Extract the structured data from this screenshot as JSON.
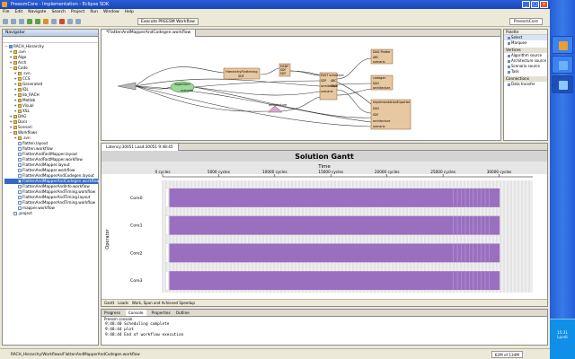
{
  "window": {
    "title": "PreesmCore - Implementation - Eclipse SDK",
    "controls": [
      "_",
      "□",
      "×"
    ]
  },
  "menubar": [
    "File",
    "Edit",
    "Navigate",
    "Search",
    "Project",
    "Run",
    "Window",
    "Help"
  ],
  "toolbar": {
    "execute_label": "Execute PREESM Workflow",
    "perspective": "PreesmCore"
  },
  "navigator": {
    "title": "Navigator",
    "rows": [
      {
        "label": "RACH_Hierarchy",
        "indent": 0,
        "kind": "proj",
        "twist": "−"
      },
      {
        "label": ".svn",
        "indent": 1,
        "kind": "folder",
        "twist": "+"
      },
      {
        "label": "Algo",
        "indent": 1,
        "kind": "folder",
        "twist": "+"
      },
      {
        "label": "Arch",
        "indent": 1,
        "kind": "folder",
        "twist": "+"
      },
      {
        "label": "Code",
        "indent": 1,
        "kind": "folder",
        "twist": "−"
      },
      {
        "label": ".svn",
        "indent": 2,
        "kind": "folder",
        "twist": "+"
      },
      {
        "label": "CCS",
        "indent": 2,
        "kind": "folder",
        "twist": "+"
      },
      {
        "label": "Generated",
        "indent": 2,
        "kind": "folder",
        "twist": "+"
      },
      {
        "label": "IDL",
        "indent": 2,
        "kind": "folder",
        "twist": "+"
      },
      {
        "label": "lib_RACH",
        "indent": 2,
        "kind": "folder",
        "twist": "+"
      },
      {
        "label": "Matlab",
        "indent": 2,
        "kind": "folder",
        "twist": "+"
      },
      {
        "label": "Visual",
        "indent": 2,
        "kind": "folder",
        "twist": "+"
      },
      {
        "label": "XSL",
        "indent": 2,
        "kind": "folder",
        "twist": "+"
      },
      {
        "label": "DAG",
        "indent": 1,
        "kind": "folder",
        "twist": "+"
      },
      {
        "label": "Docs",
        "indent": 1,
        "kind": "folder",
        "twist": "+"
      },
      {
        "label": "Scenari",
        "indent": 1,
        "kind": "folder",
        "twist": "+"
      },
      {
        "label": "Workflows",
        "indent": 1,
        "kind": "folder",
        "twist": "−"
      },
      {
        "label": ".svn",
        "indent": 2,
        "kind": "folder",
        "twist": "+"
      },
      {
        "label": "flatten.layout",
        "indent": 2,
        "kind": "file",
        "twist": ""
      },
      {
        "label": "flatten.workflow",
        "indent": 2,
        "kind": "file",
        "twist": ""
      },
      {
        "label": "FlattenAndFastMapper.layout",
        "indent": 2,
        "kind": "file",
        "twist": ""
      },
      {
        "label": "FlattenAndFastMapper.workflow",
        "indent": 2,
        "kind": "file",
        "twist": ""
      },
      {
        "label": "FlattenAndMapper.layout",
        "indent": 2,
        "kind": "file",
        "twist": ""
      },
      {
        "label": "FlattenAndMapper.workflow",
        "indent": 2,
        "kind": "file",
        "twist": ""
      },
      {
        "label": "FlattenAndMapperAndCodegen.layout",
        "indent": 2,
        "kind": "file",
        "twist": ""
      },
      {
        "label": "FlattenAndMapperAndCodegen.workflow",
        "indent": 2,
        "kind": "file",
        "twist": "",
        "selected": true
      },
      {
        "label": "FlattenAndMapperAndInfo.workflow",
        "indent": 2,
        "kind": "file",
        "twist": ""
      },
      {
        "label": "FlattenAndMapperAndTiming.workflow",
        "indent": 2,
        "kind": "file",
        "twist": ""
      },
      {
        "label": "FlattenAndMapperAndTiming.layout",
        "indent": 2,
        "kind": "file",
        "twist": ""
      },
      {
        "label": "FlattenAndMapperAndTiming.workflow",
        "indent": 2,
        "kind": "file",
        "twist": ""
      },
      {
        "label": "mapper.workflow",
        "indent": 2,
        "kind": "file",
        "twist": ""
      },
      {
        "label": ".project",
        "indent": 1,
        "kind": "file",
        "twist": ""
      }
    ]
  },
  "editor": {
    "tab": "*FlattenAndMapperAndCodegen.workflow",
    "nodes": {
      "hier": {
        "title": "HierarchyFlattening",
        "port": "SDF"
      },
      "algo": "algorithm",
      "scen": "scenario",
      "arch": "architecture",
      "hsdf": {
        "title": "HSDF",
        "ports": [
          "SDF",
          "SDF"
        ]
      },
      "fast": {
        "title": "FAST scheduler",
        "ports": [
          "SDF",
          "architecture",
          "scenario",
          "ABC",
          "DAG"
        ]
      },
      "plot": {
        "title": "DAG Plotter",
        "ports": [
          "ABC",
          "scenario"
        ]
      },
      "codegen": {
        "title": "codegen",
        "ports": [
          "DAG",
          "architecture"
        ]
      },
      "impl": {
        "title": "ImplementationExporter",
        "ports": [
          "DAG",
          "SDF",
          "architecture",
          "scenario"
        ]
      }
    }
  },
  "palette": {
    "title": "Palette",
    "tools": [
      "Select",
      "Marquee"
    ],
    "groups": [
      {
        "name": "Vertices",
        "items": [
          "Algorithm source",
          "Architecture source",
          "Scenario source",
          "Task"
        ]
      },
      {
        "name": "Connections",
        "items": [
          "Data transfer"
        ]
      }
    ]
  },
  "gantt": {
    "tab": "Latency:30051 Load:30051 9:48:45",
    "bottom_tabs": [
      "Gantt",
      "Loads",
      "Work, Span and Achieved Speedup"
    ]
  },
  "chart_data": {
    "type": "gantt",
    "title": "Solution Gantt",
    "xlabel": "Time",
    "ylabel": "Operator",
    "x_ticks": [
      0,
      5000,
      10000,
      15000,
      20000,
      25000,
      30000
    ],
    "x_tick_labels": [
      "0 cycles",
      "5000 cycles",
      "10000 cycles",
      "15000 cycles",
      "20000 cycles",
      "25000 cycles",
      "30000 cycles"
    ],
    "xlim": [
      0,
      33000
    ],
    "categories": [
      "Core0",
      "Core1",
      "Core2",
      "Core3"
    ],
    "series": [
      {
        "name": "Core0",
        "start": 600,
        "end": 30051
      },
      {
        "name": "Core1",
        "start": 600,
        "end": 30051
      },
      {
        "name": "Core2",
        "start": 600,
        "end": 30051
      },
      {
        "name": "Core3",
        "start": 600,
        "end": 30051
      }
    ],
    "colors": {
      "bar": "#9a6fc0",
      "bar_light": "#b89ad6"
    }
  },
  "console": {
    "tabs": [
      "Progress",
      "Console",
      "Properties",
      "Outline"
    ],
    "active_tab": "Console",
    "label": "Preesm console",
    "lines": [
      "9:48:40 Scheduling complete",
      "9:48:44 plot",
      "9:48:44 End of workflow execution"
    ]
  },
  "statusbar": {
    "path": "RACH_Hierarchy/Workflows/FlattenAndMapperAndCodegen.workflow",
    "right": "62M of 134M"
  },
  "taskbar": {
    "clock": "15:31",
    "day": "Lundi"
  }
}
